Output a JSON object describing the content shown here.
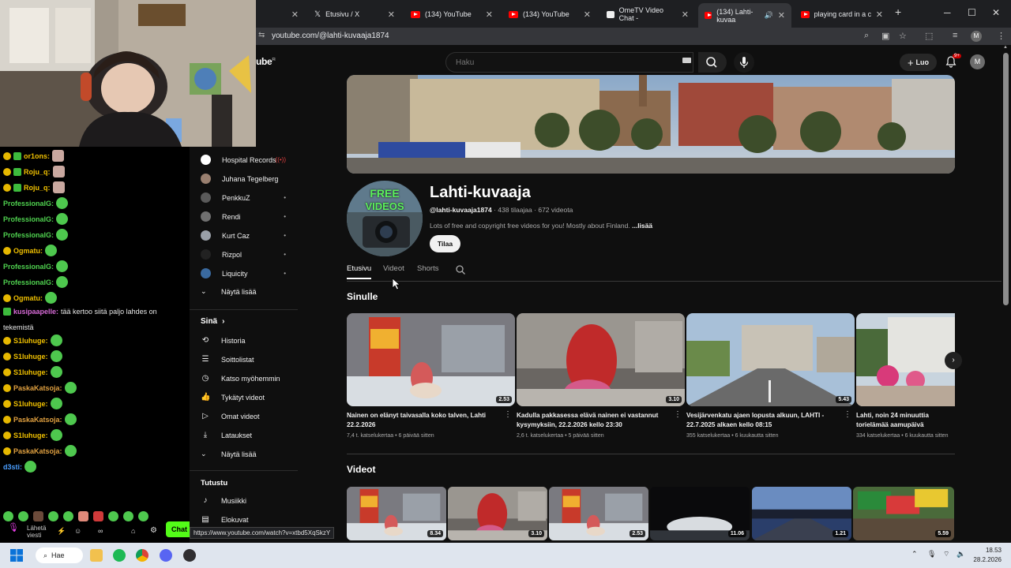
{
  "browser": {
    "tabs": [
      {
        "label": "",
        "icon": "x-icon"
      },
      {
        "label": "Etusivu / X",
        "icon": "x-logo-icon"
      },
      {
        "label": "(134) YouTube",
        "icon": "youtube-icon"
      },
      {
        "label": "(134) YouTube",
        "icon": "youtube-icon"
      },
      {
        "label": "OmeTV Video Chat -",
        "icon": "ometv-icon"
      },
      {
        "label": "(134) Lahti-kuvaa",
        "icon": "youtube-icon"
      },
      {
        "label": "playing card in a clot",
        "icon": "youtube-icon"
      }
    ],
    "url": "youtube.com/@lahti-kuvaaja1874",
    "profile_initial": "M"
  },
  "youtube": {
    "logo_text": "ube",
    "logo_sup": "FI",
    "search_placeholder": "Haku",
    "create_label": "Luo",
    "notif_count": "9+",
    "avatar_initial": "M"
  },
  "chat": {
    "messages": [
      {
        "nick": "or1ons:",
        "color": "#f0c000",
        "msg": "",
        "emote": "cat"
      },
      {
        "nick": "Roju_q:",
        "color": "#f0c000",
        "msg": "",
        "emote": "cat"
      },
      {
        "nick": "Roju_q:",
        "color": "#f0c000",
        "msg": "",
        "emote": "cat"
      },
      {
        "nick": "ProfessionalG:",
        "color": "#4fd14f",
        "msg": "",
        "emote": "green"
      },
      {
        "nick": "ProfessionalG:",
        "color": "#4fd14f",
        "msg": "",
        "emote": "green"
      },
      {
        "nick": "ProfessionalG:",
        "color": "#4fd14f",
        "msg": "",
        "emote": "green"
      },
      {
        "nick": "Ogmatu:",
        "color": "#f0c000",
        "msg": "",
        "emote": "green"
      },
      {
        "nick": "ProfessionalG:",
        "color": "#4fd14f",
        "msg": "",
        "emote": "green"
      },
      {
        "nick": "ProfessionalG:",
        "color": "#4fd14f",
        "msg": "",
        "emote": "green"
      },
      {
        "nick": "Ogmatu:",
        "color": "#f0c000",
        "msg": "",
        "emote": "green"
      },
      {
        "nick": "kusipaapelle:",
        "color": "#d86bd8",
        "msg": "tää kertoo siitä paljo lahdes on",
        "emote": ""
      },
      {
        "nick": "",
        "color": "#ffffff",
        "msg": "tekemistä",
        "emote": ""
      },
      {
        "nick": "S1luhuge:",
        "color": "#f0c000",
        "msg": "",
        "emote": "green"
      },
      {
        "nick": "S1luhuge:",
        "color": "#f0c000",
        "msg": "",
        "emote": "green"
      },
      {
        "nick": "S1luhuge:",
        "color": "#f0c000",
        "msg": "",
        "emote": "green"
      },
      {
        "nick": "PaskaKatsoja:",
        "color": "#e0a040",
        "msg": "",
        "emote": "green"
      },
      {
        "nick": "S1luhuge:",
        "color": "#f0c000",
        "msg": "",
        "emote": "green"
      },
      {
        "nick": "PaskaKatsoja:",
        "color": "#e0a040",
        "msg": "",
        "emote": "green"
      },
      {
        "nick": "S1luhuge:",
        "color": "#f0c000",
        "msg": "",
        "emote": "green"
      },
      {
        "nick": "PaskaKatsoja:",
        "color": "#e0a040",
        "msg": "",
        "emote": "green"
      },
      {
        "nick": "d3sti:",
        "color": "#4a9eff",
        "msg": "",
        "emote": "green"
      }
    ],
    "send_label": "Lähetä viesti",
    "chat_button": "Chat"
  },
  "guide": {
    "subscriptions": [
      {
        "label": "Hospital Records",
        "dot": "live"
      },
      {
        "label": "Juhana Tegelberg",
        "dot": ""
      },
      {
        "label": "PenkkuZ",
        "dot": "•"
      },
      {
        "label": "Rendi",
        "dot": "•"
      },
      {
        "label": "Kurt Caz",
        "dot": "•"
      },
      {
        "label": "Rizpol",
        "dot": "•"
      },
      {
        "label": "Liquicity",
        "dot": "•"
      }
    ],
    "show_more": "Näytä lisää",
    "you_heading": "Sinä",
    "you_items": [
      {
        "label": "Historia",
        "icon": "history-icon"
      },
      {
        "label": "Soittolistat",
        "icon": "playlists-icon"
      },
      {
        "label": "Katso myöhemmin",
        "icon": "watch-later-icon"
      },
      {
        "label": "Tykätyt videot",
        "icon": "like-icon"
      },
      {
        "label": "Omat videot",
        "icon": "your-videos-icon"
      },
      {
        "label": "Lataukset",
        "icon": "download-icon"
      }
    ],
    "show_more_2": "Näytä lisää",
    "explore_heading": "Tutustu",
    "explore_items": [
      {
        "label": "Musiikki",
        "icon": "music-icon"
      },
      {
        "label": "Elokuvat",
        "icon": "movies-icon"
      }
    ]
  },
  "channel": {
    "name": "Lahti-kuvaaja",
    "handle": "@lahti-kuvaaja1874",
    "subs": "438 tilaajaa",
    "videos_count": "672 videota",
    "description": "Lots of free and copyright free videos for you! Mostly about Finland.",
    "more": "...lisää",
    "subscribe": "Tilaa",
    "avatar_text_1": "FREE",
    "avatar_text_2": "VIDEOS",
    "tabs": [
      "Etusivu",
      "Videot",
      "Shorts"
    ]
  },
  "sections": {
    "for_you": "Sinulle",
    "videos": "Videot"
  },
  "for_you_cards": [
    {
      "title": "Nainen on elänyt taivasalla koko talven, Lahti 22.2.2026",
      "meta": "7,4 t. katselukertaa • 6 päivää sitten",
      "duration": "2.53",
      "thumb": "poster"
    },
    {
      "title": "Kadulla pakkasessa elävä nainen ei vastannut kysymyksiin, 22.2.2026 kello 23:30",
      "meta": "2,6 t. katselukertaa • 5 päivää sitten",
      "duration": "3.10",
      "thumb": "red"
    },
    {
      "title": "Vesijärvenkatu ajaen lopusta alkuun, LAHTI - 22.7.2025 alkaen kello 08:15",
      "meta": "355 katselukertaa • 6 kuukautta sitten",
      "duration": "5.43",
      "thumb": "street"
    },
    {
      "title": "Lahti, noin 24 minuuttia torielämää aamupäivä",
      "meta": "334 katselukertaa • 6 kuukautta sitten",
      "duration": "",
      "thumb": "square"
    }
  ],
  "video_row": [
    {
      "duration": "8.34",
      "thumb": "poster"
    },
    {
      "duration": "3.10",
      "thumb": "red"
    },
    {
      "duration": "2.53",
      "thumb": "poster"
    },
    {
      "duration": "11.06",
      "thumb": "night"
    },
    {
      "duration": "1.21",
      "thumb": "dusk"
    },
    {
      "duration": "5.59",
      "thumb": "flags"
    }
  ],
  "status_url": "https://www.youtube.com/watch?v=xtbd5XqSkzY",
  "taskbar": {
    "search_label": "Hae",
    "time": "18.53",
    "date": "28.2.2026"
  }
}
